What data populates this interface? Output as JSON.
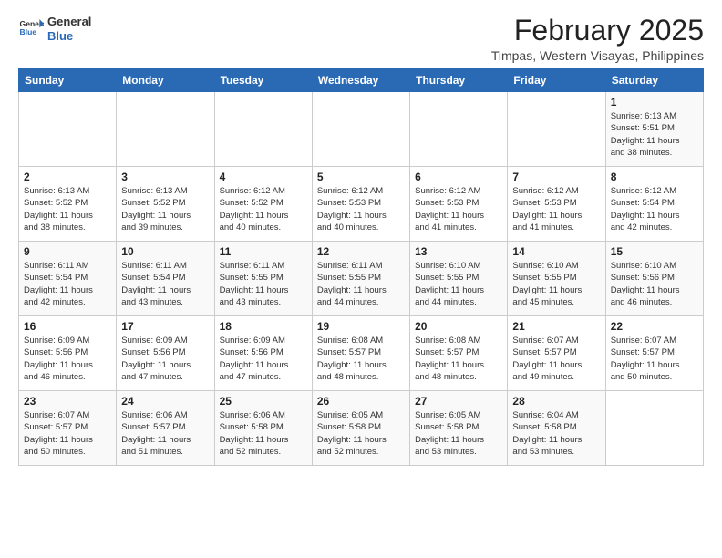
{
  "header": {
    "logo_line1": "General",
    "logo_line2": "Blue",
    "title": "February 2025",
    "subtitle": "Timpas, Western Visayas, Philippines"
  },
  "weekdays": [
    "Sunday",
    "Monday",
    "Tuesday",
    "Wednesday",
    "Thursday",
    "Friday",
    "Saturday"
  ],
  "weeks": [
    [
      {
        "day": "",
        "info": ""
      },
      {
        "day": "",
        "info": ""
      },
      {
        "day": "",
        "info": ""
      },
      {
        "day": "",
        "info": ""
      },
      {
        "day": "",
        "info": ""
      },
      {
        "day": "",
        "info": ""
      },
      {
        "day": "1",
        "info": "Sunrise: 6:13 AM\nSunset: 5:51 PM\nDaylight: 11 hours\nand 38 minutes."
      }
    ],
    [
      {
        "day": "2",
        "info": "Sunrise: 6:13 AM\nSunset: 5:52 PM\nDaylight: 11 hours\nand 38 minutes."
      },
      {
        "day": "3",
        "info": "Sunrise: 6:13 AM\nSunset: 5:52 PM\nDaylight: 11 hours\nand 39 minutes."
      },
      {
        "day": "4",
        "info": "Sunrise: 6:12 AM\nSunset: 5:52 PM\nDaylight: 11 hours\nand 40 minutes."
      },
      {
        "day": "5",
        "info": "Sunrise: 6:12 AM\nSunset: 5:53 PM\nDaylight: 11 hours\nand 40 minutes."
      },
      {
        "day": "6",
        "info": "Sunrise: 6:12 AM\nSunset: 5:53 PM\nDaylight: 11 hours\nand 41 minutes."
      },
      {
        "day": "7",
        "info": "Sunrise: 6:12 AM\nSunset: 5:53 PM\nDaylight: 11 hours\nand 41 minutes."
      },
      {
        "day": "8",
        "info": "Sunrise: 6:12 AM\nSunset: 5:54 PM\nDaylight: 11 hours\nand 42 minutes."
      }
    ],
    [
      {
        "day": "9",
        "info": "Sunrise: 6:11 AM\nSunset: 5:54 PM\nDaylight: 11 hours\nand 42 minutes."
      },
      {
        "day": "10",
        "info": "Sunrise: 6:11 AM\nSunset: 5:54 PM\nDaylight: 11 hours\nand 43 minutes."
      },
      {
        "day": "11",
        "info": "Sunrise: 6:11 AM\nSunset: 5:55 PM\nDaylight: 11 hours\nand 43 minutes."
      },
      {
        "day": "12",
        "info": "Sunrise: 6:11 AM\nSunset: 5:55 PM\nDaylight: 11 hours\nand 44 minutes."
      },
      {
        "day": "13",
        "info": "Sunrise: 6:10 AM\nSunset: 5:55 PM\nDaylight: 11 hours\nand 44 minutes."
      },
      {
        "day": "14",
        "info": "Sunrise: 6:10 AM\nSunset: 5:55 PM\nDaylight: 11 hours\nand 45 minutes."
      },
      {
        "day": "15",
        "info": "Sunrise: 6:10 AM\nSunset: 5:56 PM\nDaylight: 11 hours\nand 46 minutes."
      }
    ],
    [
      {
        "day": "16",
        "info": "Sunrise: 6:09 AM\nSunset: 5:56 PM\nDaylight: 11 hours\nand 46 minutes."
      },
      {
        "day": "17",
        "info": "Sunrise: 6:09 AM\nSunset: 5:56 PM\nDaylight: 11 hours\nand 47 minutes."
      },
      {
        "day": "18",
        "info": "Sunrise: 6:09 AM\nSunset: 5:56 PM\nDaylight: 11 hours\nand 47 minutes."
      },
      {
        "day": "19",
        "info": "Sunrise: 6:08 AM\nSunset: 5:57 PM\nDaylight: 11 hours\nand 48 minutes."
      },
      {
        "day": "20",
        "info": "Sunrise: 6:08 AM\nSunset: 5:57 PM\nDaylight: 11 hours\nand 48 minutes."
      },
      {
        "day": "21",
        "info": "Sunrise: 6:07 AM\nSunset: 5:57 PM\nDaylight: 11 hours\nand 49 minutes."
      },
      {
        "day": "22",
        "info": "Sunrise: 6:07 AM\nSunset: 5:57 PM\nDaylight: 11 hours\nand 50 minutes."
      }
    ],
    [
      {
        "day": "23",
        "info": "Sunrise: 6:07 AM\nSunset: 5:57 PM\nDaylight: 11 hours\nand 50 minutes."
      },
      {
        "day": "24",
        "info": "Sunrise: 6:06 AM\nSunset: 5:57 PM\nDaylight: 11 hours\nand 51 minutes."
      },
      {
        "day": "25",
        "info": "Sunrise: 6:06 AM\nSunset: 5:58 PM\nDaylight: 11 hours\nand 52 minutes."
      },
      {
        "day": "26",
        "info": "Sunrise: 6:05 AM\nSunset: 5:58 PM\nDaylight: 11 hours\nand 52 minutes."
      },
      {
        "day": "27",
        "info": "Sunrise: 6:05 AM\nSunset: 5:58 PM\nDaylight: 11 hours\nand 53 minutes."
      },
      {
        "day": "28",
        "info": "Sunrise: 6:04 AM\nSunset: 5:58 PM\nDaylight: 11 hours\nand 53 minutes."
      },
      {
        "day": "",
        "info": ""
      }
    ]
  ]
}
